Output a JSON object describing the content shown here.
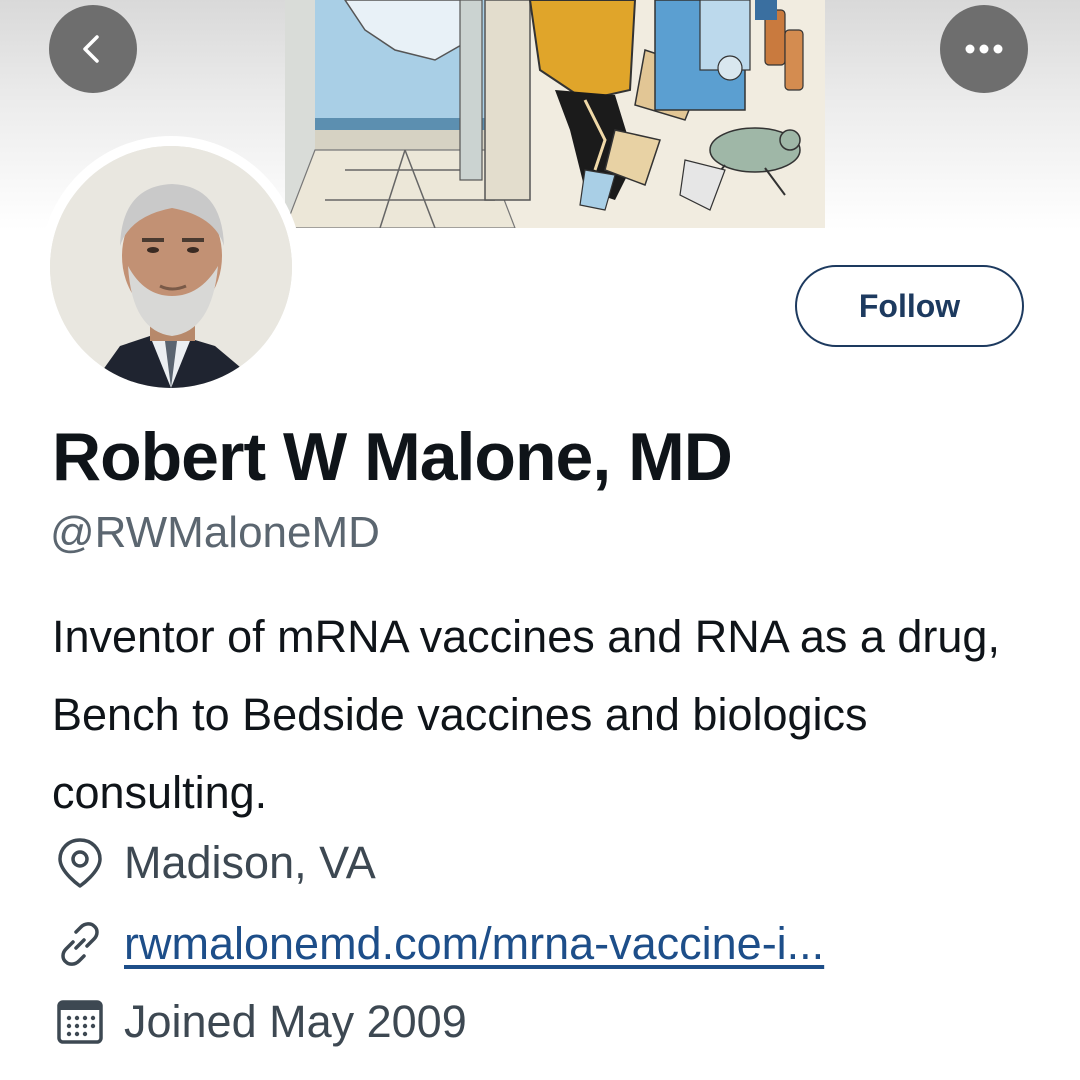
{
  "header": {
    "back_icon": "chevron-left-icon",
    "more_icon": "more-horizontal-icon"
  },
  "profile": {
    "follow_label": "Follow",
    "name": "Robert W Malone, MD",
    "handle": "@RWMaloneMD",
    "bio": "Inventor of mRNA vaccines and RNA as a drug, Bench to Bedside vaccines and biologics consulting.",
    "location": "Madison, VA",
    "website": "rwmalonemd.com/mrna-vaccine-i...",
    "joined": "Joined May 2009"
  },
  "colors": {
    "accent": "#1d3a5f",
    "link": "#1d4e89",
    "secondary_text": "#5b6670",
    "circle_button": "#6e6e6e"
  }
}
